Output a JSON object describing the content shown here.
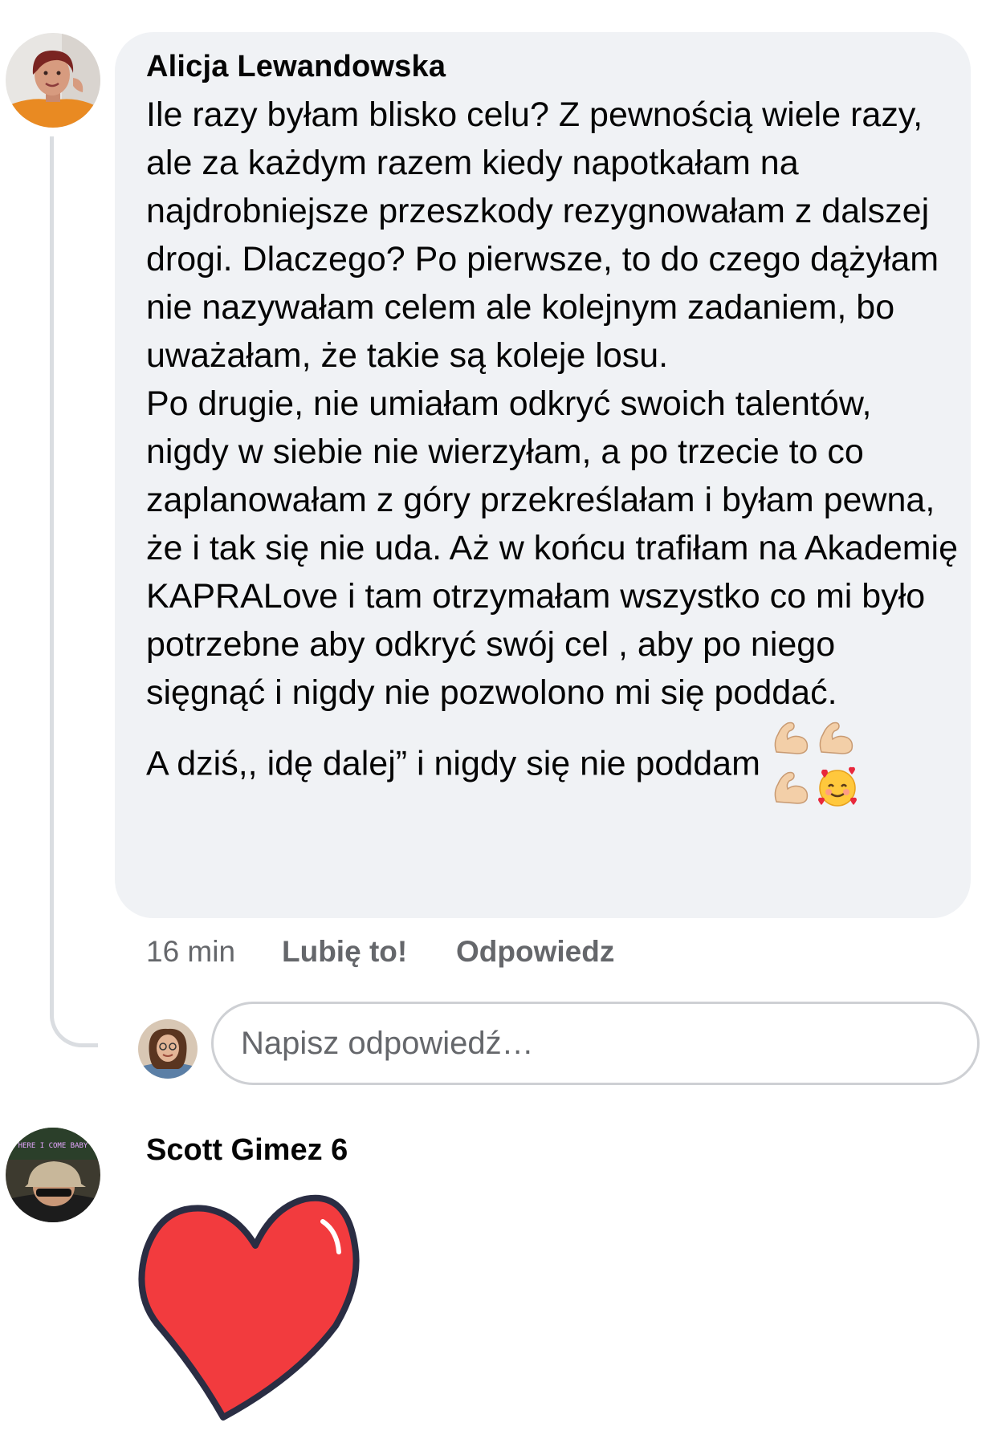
{
  "comment": {
    "author": "Alicja Lewandowska",
    "text": "Ile razy byłam blisko celu? Z pewnością wiele razy, ale za każdym razem kiedy napotkałam na najdrobniejsze przeszkody rezygnowałam z dalszej drogi. Dlaczego? Po pierwsze, to do czego dążyłam nie nazywałam celem ale kolejnym zadaniem, bo uważałam, że takie są koleje losu.\nPo drugie, nie umiałam odkryć swoich talentów, nigdy w siebie nie wierzyłam, a po trzecie to co zaplanowałam z góry przekreślałam i byłam pewna, że i tak się nie uda. Aż w końcu trafiłam na Akademię KAPRALove i tam otrzymałam wszystko co mi było potrzebne aby odkryć swój cel , aby po niego sięgnąć i nigdy nie pozwolono mi się poddać.\nA dziś,, idę dalej” i nigdy się nie poddam",
    "emojis": [
      "flexed-biceps-icon",
      "flexed-biceps-icon",
      "flexed-biceps-icon",
      "smiling-face-with-hearts-icon"
    ],
    "timestamp": "16 min",
    "like_label": "Lubię to!",
    "reply_label": "Odpowiedz"
  },
  "reply_box": {
    "placeholder": "Napisz odpowiedź…"
  },
  "comment2": {
    "author": "Scott Gimez 6",
    "avatar_caption": "HERE I COME BABY",
    "sticker": "red-heart-icon"
  },
  "colors": {
    "bubble": "#f0f2f5",
    "meta_text": "#65676b",
    "heart": "#f23b3e",
    "heart_outline": "#2a2d43"
  }
}
